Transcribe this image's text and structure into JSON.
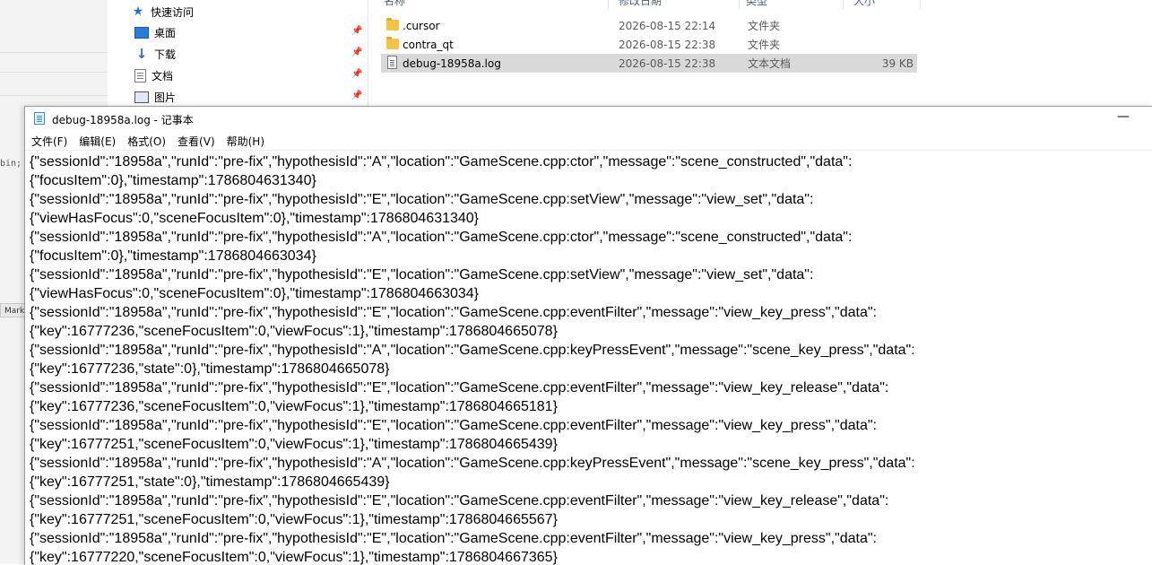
{
  "explorer": {
    "nav": [
      {
        "label": "快速访问",
        "icon": "star-icon"
      },
      {
        "label": "桌面",
        "icon": "desktop-icon",
        "pinned": true
      },
      {
        "label": "下载",
        "icon": "download-icon",
        "pinned": true
      },
      {
        "label": "文档",
        "icon": "documents-icon",
        "pinned": true
      },
      {
        "label": "图片",
        "icon": "pictures-icon",
        "pinned": true
      }
    ],
    "columns": [
      "名称",
      "修改日期",
      "类型",
      "大小"
    ],
    "files": [
      {
        "name": ".cursor",
        "date": "2026-08-15 22:14",
        "type": "文件夹",
        "size": "",
        "icon": "folder-icon"
      },
      {
        "name": "contra_qt",
        "date": "2026-08-15 22:38",
        "type": "文件夹",
        "size": "",
        "icon": "folder-icon"
      },
      {
        "name": "debug-18958a.log",
        "date": "2026-08-15 22:38",
        "type": "文本文档",
        "size": "39 KB",
        "icon": "text-file-icon",
        "selected": true
      }
    ]
  },
  "background": {
    "code_fragment": "bin;",
    "tab_label": "Mark"
  },
  "notepad": {
    "title": "debug-18958a.log - 记事本",
    "minimize_glyph": "—",
    "menu": [
      "文件(F)",
      "编辑(E)",
      "格式(O)",
      "查看(V)",
      "帮助(H)"
    ],
    "lines": [
      "{\"sessionId\":\"18958a\",\"runId\":\"pre-fix\",\"hypothesisId\":\"A\",\"location\":\"GameScene.cpp:ctor\",\"message\":\"scene_constructed\",\"data\":",
      "{\"focusItem\":0},\"timestamp\":1786804631340}",
      "{\"sessionId\":\"18958a\",\"runId\":\"pre-fix\",\"hypothesisId\":\"E\",\"location\":\"GameScene.cpp:setView\",\"message\":\"view_set\",\"data\":",
      "{\"viewHasFocus\":0,\"sceneFocusItem\":0},\"timestamp\":1786804631340}",
      "{\"sessionId\":\"18958a\",\"runId\":\"pre-fix\",\"hypothesisId\":\"A\",\"location\":\"GameScene.cpp:ctor\",\"message\":\"scene_constructed\",\"data\":",
      "{\"focusItem\":0},\"timestamp\":1786804663034}",
      "{\"sessionId\":\"18958a\",\"runId\":\"pre-fix\",\"hypothesisId\":\"E\",\"location\":\"GameScene.cpp:setView\",\"message\":\"view_set\",\"data\":",
      "{\"viewHasFocus\":0,\"sceneFocusItem\":0},\"timestamp\":1786804663034}",
      "{\"sessionId\":\"18958a\",\"runId\":\"pre-fix\",\"hypothesisId\":\"E\",\"location\":\"GameScene.cpp:eventFilter\",\"message\":\"view_key_press\",\"data\":",
      "{\"key\":16777236,\"sceneFocusItem\":0,\"viewFocus\":1},\"timestamp\":1786804665078}",
      "{\"sessionId\":\"18958a\",\"runId\":\"pre-fix\",\"hypothesisId\":\"A\",\"location\":\"GameScene.cpp:keyPressEvent\",\"message\":\"scene_key_press\",\"data\":",
      "{\"key\":16777236,\"state\":0},\"timestamp\":1786804665078}",
      "{\"sessionId\":\"18958a\",\"runId\":\"pre-fix\",\"hypothesisId\":\"E\",\"location\":\"GameScene.cpp:eventFilter\",\"message\":\"view_key_release\",\"data\":",
      "{\"key\":16777236,\"sceneFocusItem\":0,\"viewFocus\":1},\"timestamp\":1786804665181}",
      "{\"sessionId\":\"18958a\",\"runId\":\"pre-fix\",\"hypothesisId\":\"E\",\"location\":\"GameScene.cpp:eventFilter\",\"message\":\"view_key_press\",\"data\":",
      "{\"key\":16777251,\"sceneFocusItem\":0,\"viewFocus\":1},\"timestamp\":1786804665439}",
      "{\"sessionId\":\"18958a\",\"runId\":\"pre-fix\",\"hypothesisId\":\"A\",\"location\":\"GameScene.cpp:keyPressEvent\",\"message\":\"scene_key_press\",\"data\":",
      "{\"key\":16777251,\"state\":0},\"timestamp\":1786804665439}",
      "{\"sessionId\":\"18958a\",\"runId\":\"pre-fix\",\"hypothesisId\":\"E\",\"location\":\"GameScene.cpp:eventFilter\",\"message\":\"view_key_release\",\"data\":",
      "{\"key\":16777251,\"sceneFocusItem\":0,\"viewFocus\":1},\"timestamp\":1786804665567}",
      "{\"sessionId\":\"18958a\",\"runId\":\"pre-fix\",\"hypothesisId\":\"E\",\"location\":\"GameScene.cpp:eventFilter\",\"message\":\"view_key_press\",\"data\":",
      "{\"key\":16777220,\"sceneFocusItem\":0,\"viewFocus\":1},\"timestamp\":1786804667365}"
    ]
  }
}
